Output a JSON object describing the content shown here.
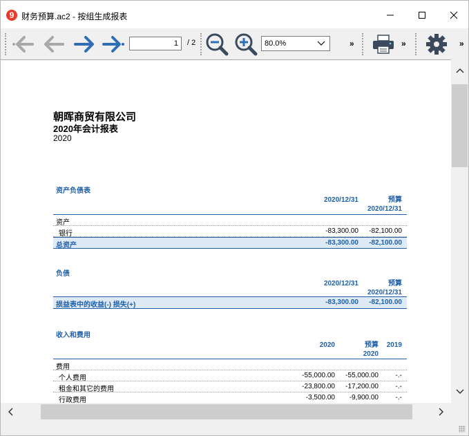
{
  "window": {
    "title": "财务预算.ac2 - 按组生成报表",
    "app_icon_glyph": "9"
  },
  "toolbar": {
    "current_page": "1",
    "total_pages": "/ 2",
    "zoom": "80.0%",
    "overflow": "»"
  },
  "report": {
    "company": "朝晖商贸有限公司",
    "title": "2020年会计报表",
    "year": "2020",
    "balance_sheet": {
      "title": "资产负债表",
      "col1": "2020/12/31",
      "col2_line1": "预算",
      "col2_line2": "2020/12/31",
      "assets_group": "资产",
      "rows": [
        {
          "label": "银行",
          "v1": "-83,300.00",
          "v2": "-82,100.00"
        }
      ],
      "total": {
        "label": "总资产",
        "v1": "-83,300.00",
        "v2": "-82,100.00"
      }
    },
    "liabilities": {
      "title": "负债",
      "col1": "2020/12/31",
      "col2_line1": "预算",
      "col2_line2": "2020/12/31",
      "total": {
        "label": "损益表中的收益(-) 损失(+)",
        "v1": "-83,300.00",
        "v2": "-82,100.00"
      }
    },
    "income": {
      "title": "收入和费用",
      "col1": "2020",
      "col2_line1": "预算",
      "col2_line2": "2020",
      "col3": "2019",
      "expense_group": "费用",
      "rows": [
        {
          "label": "个人费用",
          "v1": "-55,000.00",
          "v2": "-55,000.00",
          "v3": "-.-"
        },
        {
          "label": "租金和其它的费用",
          "v1": "-23,800.00",
          "v2": "-17,200.00",
          "v3": "-.-"
        },
        {
          "label": "行政费用",
          "v1": "-3,500.00",
          "v2": "-9,900.00",
          "v3": "-.-"
        }
      ]
    }
  },
  "colors": {
    "accent": "#1f5fa8",
    "nav_arrow_active": "#2f6db5",
    "nav_arrow_disabled": "#a8a8a8",
    "total_row_bg": "#dde9f5"
  }
}
